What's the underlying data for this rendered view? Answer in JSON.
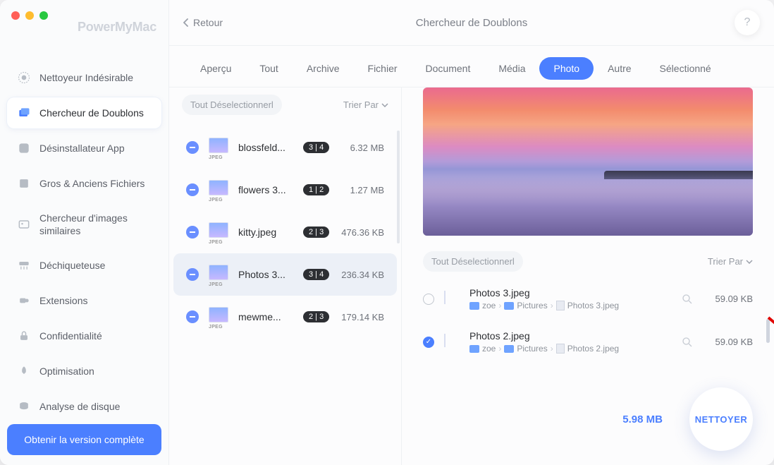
{
  "brand": "PowerMyMac",
  "back_label": "Retour",
  "page_title": "Chercheur de Doublons",
  "help_label": "?",
  "sidebar": {
    "items": [
      {
        "label": "Nettoyeur Indésirable"
      },
      {
        "label": "Chercheur de Doublons"
      },
      {
        "label": "Désinstallateur App"
      },
      {
        "label": "Gros & Anciens Fichiers"
      },
      {
        "label": "Chercheur d'images similaires"
      },
      {
        "label": "Déchiqueteuse"
      },
      {
        "label": "Extensions"
      },
      {
        "label": "Confidentialité"
      },
      {
        "label": "Optimisation"
      },
      {
        "label": "Analyse de disque"
      }
    ],
    "cta": "Obtenir la version complète"
  },
  "tabs": [
    "Aperçu",
    "Tout",
    "Archive",
    "Fichier",
    "Document",
    "Média",
    "Photo",
    "Autre",
    "Sélectionné"
  ],
  "active_tab": "Photo",
  "deselect_label": "Tout Déselectionnerl",
  "sort_label": "Trier Par",
  "files": [
    {
      "name": "blossfeld...",
      "badge": "3 | 4",
      "size": "6.32 MB",
      "thumb_label": "JPEG"
    },
    {
      "name": "flowers 3...",
      "badge": "1 | 2",
      "size": "1.27 MB",
      "thumb_label": "JPEG"
    },
    {
      "name": "kitty.jpeg",
      "badge": "2 | 3",
      "size": "476.36 KB",
      "thumb_label": "JPEG"
    },
    {
      "name": "Photos 3...",
      "badge": "3 | 4",
      "size": "236.34 KB",
      "thumb_label": "JPEG"
    },
    {
      "name": "mewme...",
      "badge": "2 | 3",
      "size": "179.14 KB",
      "thumb_label": "JPEG"
    }
  ],
  "dups": [
    {
      "checked": false,
      "name": "Photos 3.jpeg",
      "path_user": "zoe",
      "path_folder": "Pictures",
      "path_file": "Photos 3.jpeg",
      "size": "59.09 KB"
    },
    {
      "checked": true,
      "name": "Photos 2.jpeg",
      "path_user": "zoe",
      "path_folder": "Pictures",
      "path_file": "Photos 2.jpeg",
      "size": "59.09 KB"
    }
  ],
  "total_size": "5.98 MB",
  "clean_label": "NETTOYER"
}
